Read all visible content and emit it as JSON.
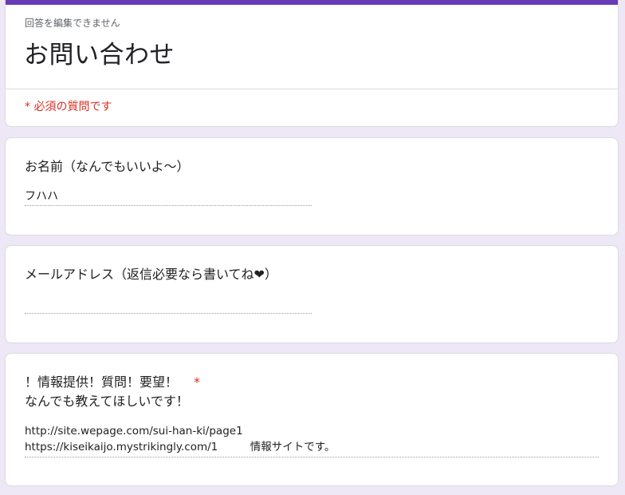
{
  "header": {
    "readonly_note": "回答を編集できません",
    "title": "お問い合わせ",
    "required_note": "* 必須の質問です"
  },
  "questions": [
    {
      "title": "お名前（なんでもいいよ～）",
      "answer": "フハハ"
    },
    {
      "title": "メールアドレス（返信必要なら書いてね❤）",
      "answer": ""
    },
    {
      "title_line1": "！情報提供！質問！要望！",
      "required_mark": "*",
      "title_line2": "なんでも教えてほしいです！",
      "answer_line1": "http://site.wepage.com/sui-han-ki/page1",
      "answer_line2": "https://kiseikaijo.mystrikingly.com/1　　　情報サイトです。"
    }
  ],
  "colors": {
    "accent": "#673ab7",
    "background": "#ede7f6",
    "required": "#d93025"
  }
}
